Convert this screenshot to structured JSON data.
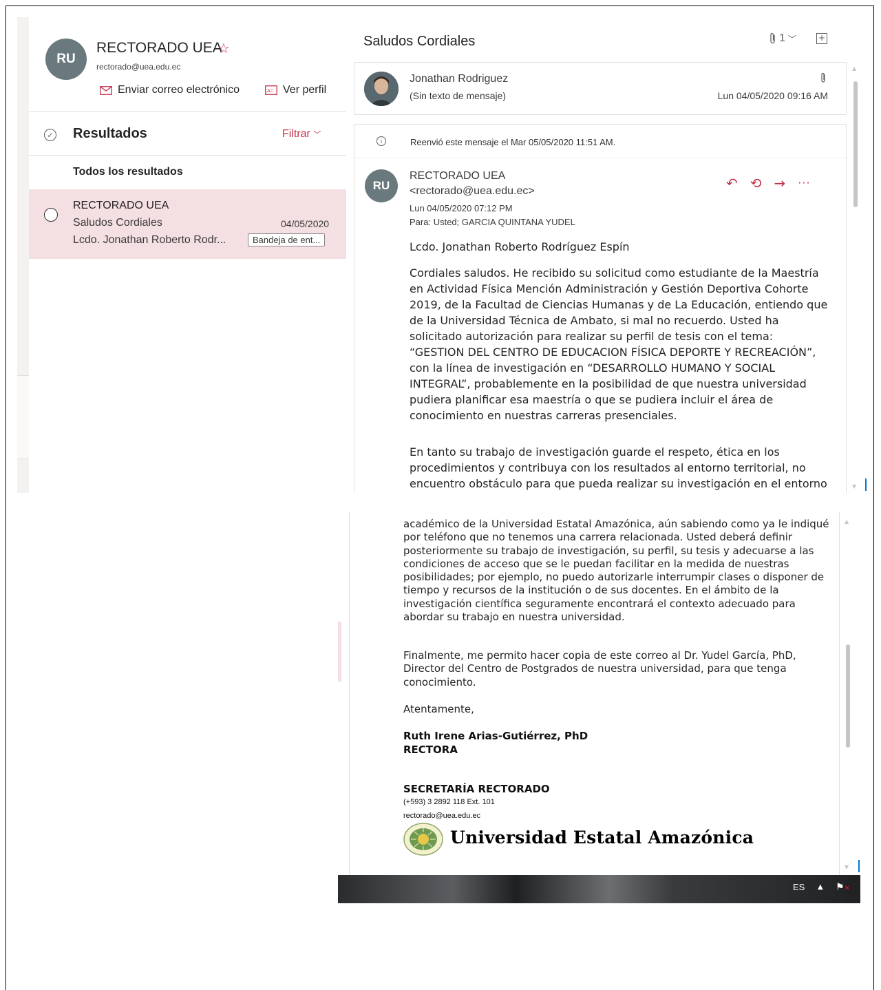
{
  "contact": {
    "initials": "RU",
    "name": "RECTORADO UEA",
    "email": "rectorado@uea.edu.ec",
    "send_email_label": "Enviar correo electrónico",
    "view_profile_label": "Ver perfil"
  },
  "results": {
    "title": "Resultados",
    "filter_label": "Filtrar",
    "all_results_label": "Todos los resultados"
  },
  "message_list": [
    {
      "sender": "RECTORADO UEA",
      "subject": "Saludos Cordiales",
      "date": "04/05/2020",
      "preview": "Lcdo. Jonathan Roberto Rodr...",
      "folder": "Bandeja de ent..."
    }
  ],
  "reading": {
    "subject": "Saludos Cordiales",
    "attachment_count": "1",
    "reply_card": {
      "sender": "Jonathan Rodriguez",
      "preview": "(Sin texto de mensaje)",
      "date": "Lun 04/05/2020 09:16 AM"
    },
    "forward_note": "Reenvió este mensaje el Mar 05/05/2020 11:51 AM.",
    "original": {
      "initials": "RU",
      "from": "RECTORADO UEA <rectorado@uea.edu.ec>",
      "date": "Lun 04/05/2020 07:12 PM",
      "to_label": "Para:",
      "to": "Usted; GARCIA QUINTANA YUDEL"
    },
    "greeting": "Lcdo. Jonathan Roberto Rodríguez Espín",
    "paragraph1": "Cordiales saludos. He recibido su solicitud como estudiante de la Maestría en Actividad Física Mención Administración y Gestión Deportiva Cohorte 2019, de la Facultad de Ciencias Humanas y de La Educación, entiendo que de la Universidad Técnica de Ambato, si mal no recuerdo. Usted ha solicitado autorización para realizar su perfil de tesis con el tema: “GESTION DEL CENTRO DE EDUCACION FÍSICA DEPORTE Y RECREACIÓN”, con la línea de investigación en “DESARROLLO HUMANO Y SOCIAL INTEGRAL”, probablemente en la posibilidad de que nuestra universidad pudiera planificar esa maestría o que se pudiera incluir el área de conocimiento en nuestras carreras presenciales.",
    "paragraph2_start": "En tanto su trabajo de investigación guarde el respeto, ética en los procedimientos y contribuya con los resultados al entorno territorial, no encuentro obstáculo para que pueda realizar su investigación en el entorno"
  },
  "continuation": {
    "paragraph2_end": "académico de la Universidad Estatal Amazónica, aún sabiendo como ya le indiqué por teléfono que no tenemos una carrera relacionada. Usted deberá definir posteriormente su trabajo de investigación, su perfil, su tesis y adecuarse a las condiciones de acceso que se le puedan facilitar en la medida de nuestras posibilidades; por ejemplo, no puedo autorizarle interrumpir clases o disponer de tiempo y recursos de la institución o de sus docentes. En el ámbito de la investigación científica seguramente encontrará el contexto adecuado para abordar su trabajo en nuestra universidad.",
    "paragraph3": "Finalmente, me permito hacer copia de este correo al Dr. Yudel García, PhD, Director del Centro de Postgrados de nuestra universidad, para que tenga conocimiento.",
    "closing": "Atentamente,",
    "signature_name": "Ruth Irene Arias-Gutiérrez, PhD",
    "signature_title": "RECTORA",
    "secretary_title": "SECRETARÍA RECTORADO",
    "secretary_phone": "(+593) 3 2892 118 Ext. 101",
    "secretary_email": "rectorado@uea.edu.ec",
    "university_name": "Universidad Estatal Amazónica"
  },
  "taskbar": {
    "language": "ES"
  },
  "colors": {
    "accent": "#c4314b",
    "selected_row": "#f4dfe2",
    "avatar_gray": "#69797e"
  }
}
